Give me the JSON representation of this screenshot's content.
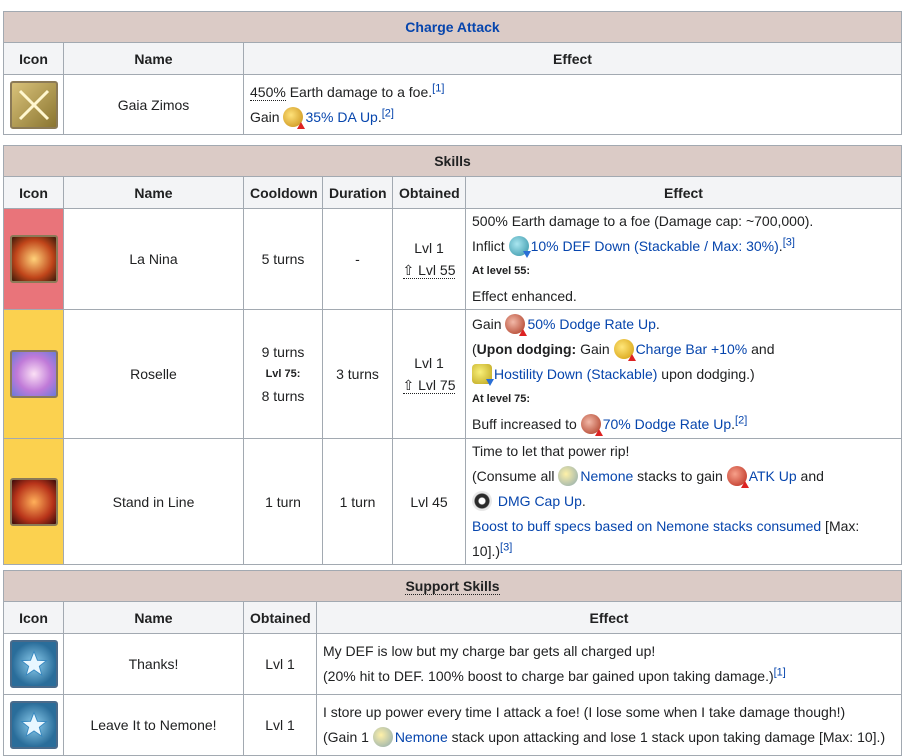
{
  "charge_attack": {
    "title": "Charge Attack",
    "headers": {
      "icon": "Icon",
      "name": "Name",
      "effect": "Effect"
    },
    "name": "Gaia Zimos",
    "line1_pct": "450%",
    "line1_text": " Earth damage to a foe.",
    "line1_ref": "[1]",
    "line2_gain": "Gain ",
    "line2_link": "35% DA Up",
    "line2_end": ".",
    "line2_ref": "[2]"
  },
  "skills": {
    "title": "Skills",
    "headers": {
      "icon": "Icon",
      "name": "Name",
      "cooldown": "Cooldown",
      "duration": "Duration",
      "obtained": "Obtained",
      "effect": "Effect"
    },
    "la_nina": {
      "name": "La Nina",
      "cooldown": "5 turns",
      "duration": "-",
      "obtained": "Lvl 1",
      "obtained_up": "⇧ Lvl 55",
      "e1": "500% Earth damage to a foe (Damage cap: ~700,000).",
      "e2_pre": "Inflict ",
      "e2_link": "10% DEF Down (Stackable / Max: 30%)",
      "e2_end": ".",
      "e2_ref": "[3]",
      "e3": "At level 55:",
      "e4": "Effect enhanced."
    },
    "roselle": {
      "name": "Roselle",
      "cooldown": "9 turns",
      "cooldown_lvl": "Lvl 75:",
      "cooldown_2": "8 turns",
      "duration": "3 turns",
      "obtained": "Lvl 1",
      "obtained_up": "⇧ Lvl 75",
      "e1_pre": "Gain ",
      "e1_link": "50% Dodge Rate Up",
      "e1_end": ".",
      "e2_open": "(",
      "e2_bold": "Upon dodging:",
      "e2_mid": " Gain ",
      "e2_link": "Charge Bar +10%",
      "e2_and": " and",
      "e3_link": "Hostility Down (Stackable)",
      "e3_end": " upon dodging.)",
      "e4": "At level 75:",
      "e5_pre": "Buff increased to ",
      "e5_link": "70% Dodge Rate Up",
      "e5_end": ".",
      "e5_ref": "[2]"
    },
    "stand_in_line": {
      "name": "Stand in Line",
      "cooldown": "1 turn",
      "duration": "1 turn",
      "obtained": "Lvl 45",
      "e1": "Time to let that power rip!",
      "e2_pre": "(Consume all ",
      "e2_link": "Nemone",
      "e2_mid": " stacks to gain ",
      "e2_link2": "ATK Up",
      "e2_and": " and",
      "e3_link": "DMG Cap Up",
      "e3_end": ".",
      "e4_link": "Boost to buff specs based on Nemone stacks consumed",
      "e4_end": " [Max:",
      "e5": "10].)",
      "e5_ref": "[3]"
    }
  },
  "support": {
    "title": "Support Skills",
    "headers": {
      "icon": "Icon",
      "name": "Name",
      "obtained": "Obtained",
      "effect": "Effect"
    },
    "thanks": {
      "name": "Thanks!",
      "obtained": "Lvl 1",
      "e1": "My DEF is low but my charge bar gets all charged up!",
      "e2": "(20% hit to DEF. 100% boost to charge bar gained upon taking damage.)",
      "e2_ref": "[1]"
    },
    "leave": {
      "name": "Leave It to Nemone!",
      "obtained": "Lvl 1",
      "e1": "I store up power every time I attack a foe! (I lose some when I take damage though!)",
      "e2_pre": "(Gain 1 ",
      "e2_link": "Nemone",
      "e2_end": " stack upon attacking and lose 1 stack upon taking damage [Max: 10].)"
    }
  },
  "colors": {
    "title_bg": "#dbcbc6",
    "header_bg": "#f3f4f6",
    "link": "#0645ad",
    "row_red": "#e9747a",
    "row_yellow": "#fbd14f"
  }
}
